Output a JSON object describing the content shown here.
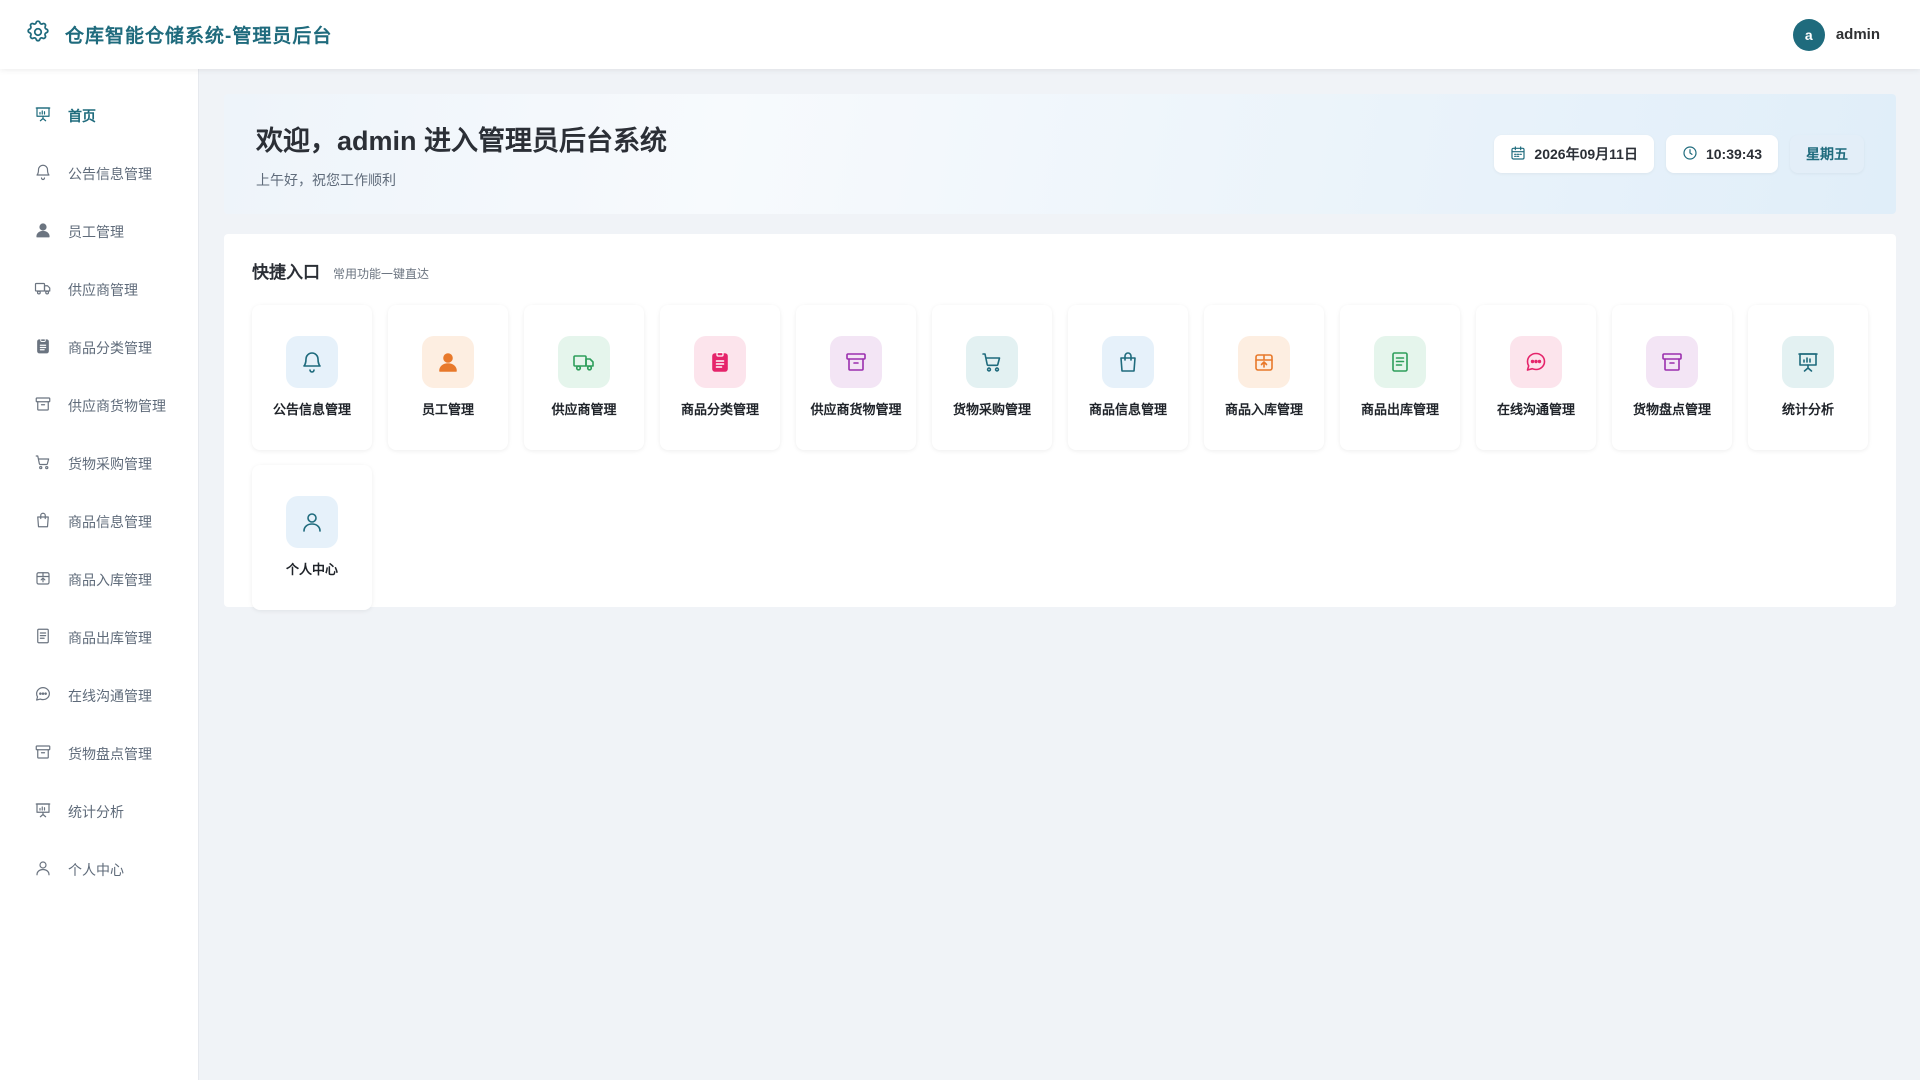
{
  "header": {
    "brand_title": "仓库智能仓储系统-管理员后台",
    "user_initial": "a",
    "user_name": "admin"
  },
  "sidebar": {
    "items": [
      {
        "label": "首页",
        "icon": "presentation-chart-icon",
        "active": true
      },
      {
        "label": "公告信息管理",
        "icon": "bell-icon"
      },
      {
        "label": "员工管理",
        "icon": "user-solid-icon"
      },
      {
        "label": "供应商管理",
        "icon": "truck-icon"
      },
      {
        "label": "商品分类管理",
        "icon": "clipboard-icon"
      },
      {
        "label": "供应商货物管理",
        "icon": "archive-box-icon"
      },
      {
        "label": "货物采购管理",
        "icon": "shopping-cart-icon"
      },
      {
        "label": "商品信息管理",
        "icon": "shopping-bag-icon"
      },
      {
        "label": "商品入库管理",
        "icon": "package-icon"
      },
      {
        "label": "商品出库管理",
        "icon": "document-list-icon"
      },
      {
        "label": "在线沟通管理",
        "icon": "chat-bubble-icon"
      },
      {
        "label": "货物盘点管理",
        "icon": "archive-box-icon"
      },
      {
        "label": "统计分析",
        "icon": "presentation-chart-icon"
      },
      {
        "label": "个人中心",
        "icon": "user-outline-icon"
      }
    ]
  },
  "welcome": {
    "title": "欢迎，admin 进入管理员后台系统",
    "subtitle": "上午好，祝您工作顺利",
    "date": "2026年09月11日",
    "time": "10:39:43",
    "weekday": "星期五"
  },
  "quick": {
    "title": "快捷入口",
    "subtitle": "常用功能一键直达",
    "cards": [
      {
        "label": "公告信息管理",
        "icon": "bell-icon",
        "color": "#1f6b7d",
        "bg": "#e6f1fa"
      },
      {
        "label": "员工管理",
        "icon": "user-solid-icon",
        "color": "#e8792b",
        "bg": "#fdeee1"
      },
      {
        "label": "供应商管理",
        "icon": "truck-icon",
        "color": "#2e9e5b",
        "bg": "#e5f5ec"
      },
      {
        "label": "商品分类管理",
        "icon": "clipboard-icon",
        "color": "#e5246b",
        "bg": "#fce4ec"
      },
      {
        "label": "供应商货物管理",
        "icon": "archive-box-icon",
        "color": "#9b2fae",
        "bg": "#f3e5f5"
      },
      {
        "label": "货物采购管理",
        "icon": "shopping-cart-icon",
        "color": "#1f6b7d",
        "bg": "#e3f1f2"
      },
      {
        "label": "商品信息管理",
        "icon": "shopping-bag-icon",
        "color": "#1f6b7d",
        "bg": "#e6f1fa"
      },
      {
        "label": "商品入库管理",
        "icon": "package-icon",
        "color": "#e8792b",
        "bg": "#fdeee1"
      },
      {
        "label": "商品出库管理",
        "icon": "document-list-icon",
        "color": "#2e9e5b",
        "bg": "#e5f5ec"
      },
      {
        "label": "在线沟通管理",
        "icon": "chat-bubble-icon",
        "color": "#e5246b",
        "bg": "#fce4ec"
      },
      {
        "label": "货物盘点管理",
        "icon": "archive-box-icon",
        "color": "#9b2fae",
        "bg": "#f3e5f5"
      },
      {
        "label": "统计分析",
        "icon": "presentation-chart-icon",
        "color": "#1f6b7d",
        "bg": "#e3f1f2"
      },
      {
        "label": "个人中心",
        "icon": "user-outline-icon",
        "color": "#1f6b7d",
        "bg": "#e6f1fa"
      }
    ]
  },
  "colors": {
    "brand": "#1f6b7d",
    "sidebar_icon": "#6b7480",
    "background": "#f0f3f7"
  }
}
